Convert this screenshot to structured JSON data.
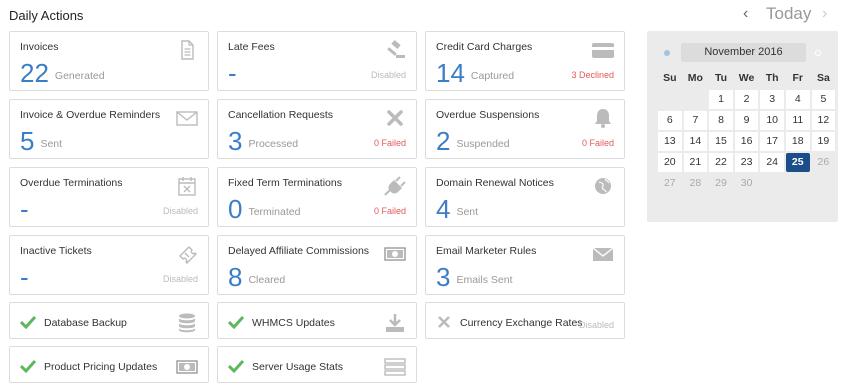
{
  "title": "Daily Actions",
  "nav": {
    "prev": "‹",
    "today": "Today",
    "next": "›"
  },
  "cards": {
    "invoices": {
      "label": "Invoices",
      "count": "22",
      "sub": "Generated",
      "icon": "document-icon"
    },
    "late_fees": {
      "label": "Late Fees",
      "count": "-",
      "status": "Disabled",
      "icon": "gavel-icon"
    },
    "credit_card": {
      "label": "Credit Card Charges",
      "count": "14",
      "sub": "Captured",
      "status": "3 Declined",
      "icon": "credit-card-icon"
    },
    "reminders": {
      "label": "Invoice & Overdue Reminders",
      "count": "5",
      "sub": "Sent",
      "icon": "envelope-icon"
    },
    "cancellations": {
      "label": "Cancellation Requests",
      "count": "3",
      "sub": "Processed",
      "status": "0 Failed",
      "icon": "x-icon"
    },
    "suspensions": {
      "label": "Overdue Suspensions",
      "count": "2",
      "sub": "Suspended",
      "status": "0 Failed",
      "icon": "bell-icon"
    },
    "terminations": {
      "label": "Overdue Terminations",
      "count": "-",
      "status": "Disabled",
      "icon": "calendar-x-icon"
    },
    "fixed_term": {
      "label": "Fixed Term Terminations",
      "count": "0",
      "sub": "Terminated",
      "status": "0 Failed",
      "icon": "plug-icon"
    },
    "domain_renewal": {
      "label": "Domain Renewal Notices",
      "count": "4",
      "sub": "Sent",
      "icon": "globe-icon"
    },
    "inactive_tickets": {
      "label": "Inactive Tickets",
      "count": "-",
      "status": "Disabled",
      "icon": "ticket-icon"
    },
    "affiliate": {
      "label": "Delayed Affiliate Commissions",
      "count": "8",
      "sub": "Cleared",
      "icon": "money-icon"
    },
    "email_marketer": {
      "label": "Email Marketer Rules",
      "count": "3",
      "sub": "Emails Sent",
      "icon": "envelope-icon"
    }
  },
  "tasks": {
    "db_backup": {
      "label": "Database Backup",
      "done": true,
      "icon": "database-icon"
    },
    "whmcs_updates": {
      "label": "WHMCS Updates",
      "done": true,
      "icon": "download-icon"
    },
    "currency": {
      "label": "Currency Exchange Rates",
      "done": false,
      "status": "Disabled"
    },
    "pricing": {
      "label": "Product Pricing Updates",
      "done": true,
      "icon": "money-icon"
    },
    "server_usage": {
      "label": "Server Usage Stats",
      "done": true,
      "icon": "server-icon"
    }
  },
  "calendar": {
    "month": "November 2016",
    "weekdays": [
      "Su",
      "Mo",
      "Tu",
      "We",
      "Th",
      "Fr",
      "Sa"
    ],
    "days": [
      [
        null,
        null,
        "1",
        "2",
        "3",
        "4",
        "5"
      ],
      [
        "6",
        "7",
        "8",
        "9",
        "10",
        "11",
        "12"
      ],
      [
        "13",
        "14",
        "15",
        "16",
        "17",
        "18",
        "19"
      ],
      [
        "20",
        "21",
        "22",
        "23",
        "24",
        "25",
        "26"
      ],
      [
        "27",
        "28",
        "29",
        "30",
        null,
        null,
        null
      ]
    ],
    "selected": "25",
    "muted": [
      "26",
      "27",
      "28",
      "29",
      "30"
    ]
  },
  "colors": {
    "accent": "#3b7ec6",
    "failed": "#e25b5b",
    "check": "#5cb85c",
    "today_bg": "#1b4d8a"
  }
}
